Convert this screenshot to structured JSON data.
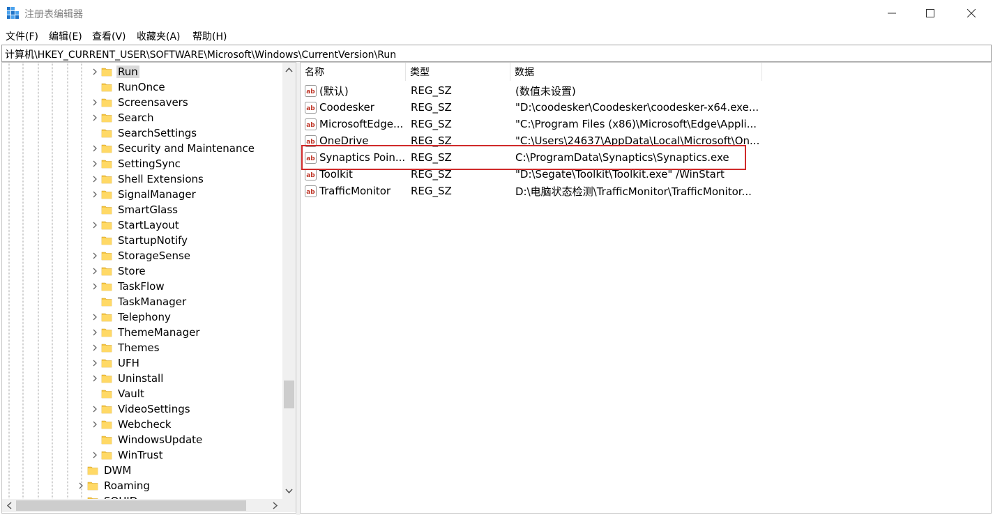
{
  "window": {
    "title": "注册表编辑器",
    "controls": {
      "minimize": "minimize",
      "maximize": "maximize",
      "close": "close"
    }
  },
  "menu": [
    {
      "label": "文件(F)"
    },
    {
      "label": "编辑(E)"
    },
    {
      "label": "查看(V)"
    },
    {
      "label": "收藏夹(A)"
    },
    {
      "label": "帮助(H)"
    }
  ],
  "address": "计算机\\HKEY_CURRENT_USER\\SOFTWARE\\Microsoft\\Windows\\CurrentVersion\\Run",
  "tree": {
    "items": [
      {
        "label": "Run",
        "expandable": true,
        "selected": true,
        "level": 1
      },
      {
        "label": "RunOnce",
        "expandable": false,
        "level": 1
      },
      {
        "label": "Screensavers",
        "expandable": true,
        "level": 1
      },
      {
        "label": "Search",
        "expandable": true,
        "level": 1
      },
      {
        "label": "SearchSettings",
        "expandable": false,
        "level": 1
      },
      {
        "label": "Security and Maintenance",
        "expandable": true,
        "level": 1
      },
      {
        "label": "SettingSync",
        "expandable": true,
        "level": 1
      },
      {
        "label": "Shell Extensions",
        "expandable": true,
        "level": 1
      },
      {
        "label": "SignalManager",
        "expandable": true,
        "level": 1
      },
      {
        "label": "SmartGlass",
        "expandable": false,
        "level": 1
      },
      {
        "label": "StartLayout",
        "expandable": true,
        "level": 1
      },
      {
        "label": "StartupNotify",
        "expandable": false,
        "level": 1
      },
      {
        "label": "StorageSense",
        "expandable": true,
        "level": 1
      },
      {
        "label": "Store",
        "expandable": true,
        "level": 1
      },
      {
        "label": "TaskFlow",
        "expandable": true,
        "level": 1
      },
      {
        "label": "TaskManager",
        "expandable": false,
        "level": 1
      },
      {
        "label": "Telephony",
        "expandable": true,
        "level": 1
      },
      {
        "label": "ThemeManager",
        "expandable": true,
        "level": 1
      },
      {
        "label": "Themes",
        "expandable": true,
        "level": 1
      },
      {
        "label": "UFH",
        "expandable": true,
        "level": 1
      },
      {
        "label": "Uninstall",
        "expandable": true,
        "level": 1
      },
      {
        "label": "Vault",
        "expandable": false,
        "level": 1
      },
      {
        "label": "VideoSettings",
        "expandable": true,
        "level": 1
      },
      {
        "label": "Webcheck",
        "expandable": true,
        "level": 1
      },
      {
        "label": "WindowsUpdate",
        "expandable": false,
        "level": 1
      },
      {
        "label": "WinTrust",
        "expandable": true,
        "level": 1
      },
      {
        "label": "DWM",
        "expandable": false,
        "level": 0
      },
      {
        "label": "Roaming",
        "expandable": true,
        "level": 0
      },
      {
        "label": "SQUID",
        "expandable": false,
        "level": 0
      }
    ]
  },
  "list": {
    "columns": [
      {
        "label": "名称"
      },
      {
        "label": "类型"
      },
      {
        "label": "数据"
      }
    ],
    "rows": [
      {
        "name": "(默认)",
        "type": "REG_SZ",
        "data": "(数值未设置)"
      },
      {
        "name": "Coodesker",
        "type": "REG_SZ",
        "data": "\"D:\\coodesker\\Coodesker\\coodesker-x64.exe..."
      },
      {
        "name": "MicrosoftEdge...",
        "type": "REG_SZ",
        "data": "\"C:\\Program Files (x86)\\Microsoft\\Edge\\Appli..."
      },
      {
        "name": "OneDrive",
        "type": "REG_SZ",
        "data": "\"C:\\Users\\24637\\AppData\\Local\\Microsoft\\On..."
      },
      {
        "name": "Synaptics Poin...",
        "type": "REG_SZ",
        "data": "C:\\ProgramData\\Synaptics\\Synaptics.exe",
        "highlighted": true
      },
      {
        "name": "Toolkit",
        "type": "REG_SZ",
        "data": "\"D:\\Segate\\Toolkit\\Toolkit.exe\" /WinStart"
      },
      {
        "name": "TrafficMonitor",
        "type": "REG_SZ",
        "data": "D:\\电脑状态检测\\TrafficMonitor\\TrafficMonitor..."
      }
    ]
  },
  "colors": {
    "highlight_border": "#d02a2a",
    "folder": "#f5c542",
    "selected_bg": "#d9d9d9",
    "ab_icon": "#c0392b"
  },
  "icons": {
    "app": "registry-editor-icon",
    "folder": "folder-icon",
    "value": "string-value-icon",
    "expand": "chevron-right-icon"
  }
}
